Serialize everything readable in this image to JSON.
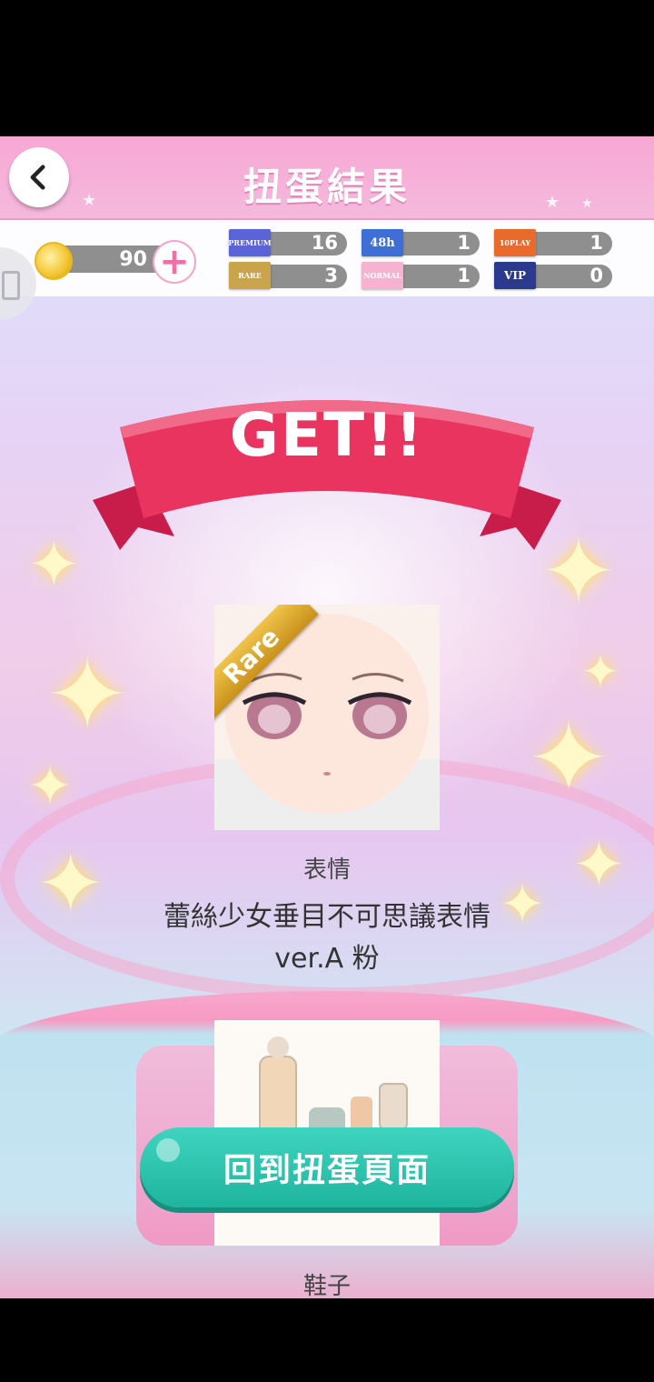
{
  "header": {
    "title": "扭蛋結果"
  },
  "currency": {
    "coins": "90",
    "tickets": [
      {
        "badge": "PREMIUM",
        "value": "16",
        "color": "#5b63d8"
      },
      {
        "badge": "48h",
        "value": "1",
        "color": "#3f6fd6"
      },
      {
        "badge": "10PLAY",
        "value": "1",
        "color": "#e86b2b"
      },
      {
        "badge": "RARE",
        "value": "3",
        "color": "#c9a44a"
      },
      {
        "badge": "NORMAL",
        "value": "1",
        "color": "#f5b3d1"
      },
      {
        "badge": "VIP",
        "value": "0",
        "color": "#2b3a8c"
      }
    ]
  },
  "result": {
    "banner": "GET!!",
    "rarity_badge": "Rare",
    "item1": {
      "category": "表情",
      "name": "蕾絲少女垂目不可思議表情 ver.A 粉"
    },
    "item2": {
      "category": "鞋子"
    }
  },
  "actions": {
    "return_label": "回到扭蛋頁面"
  }
}
